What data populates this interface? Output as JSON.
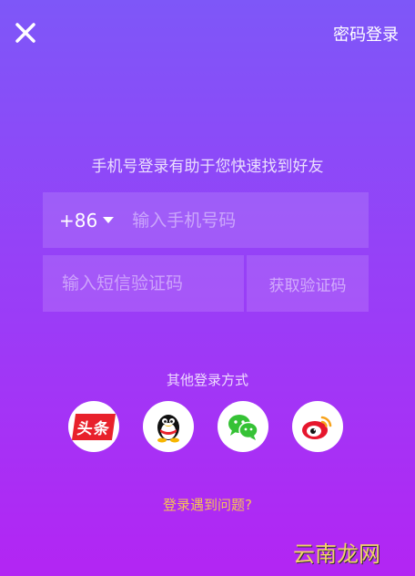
{
  "header": {
    "close_icon": "close-icon",
    "password_login_label": "密码登录"
  },
  "subtitle": "手机号登录有助于您快速找到好友",
  "phone": {
    "country_code": "+86",
    "placeholder": "输入手机号码",
    "value": ""
  },
  "sms": {
    "placeholder": "输入短信验证码",
    "value": "",
    "get_code_label": "获取验证码"
  },
  "other_login": {
    "title": "其他登录方式",
    "providers": [
      {
        "name": "toutiao",
        "label": "头条",
        "color": "#e8212b"
      },
      {
        "name": "qq",
        "icon": "qq-penguin-icon"
      },
      {
        "name": "wechat",
        "icon": "wechat-icon",
        "color": "#35c235"
      },
      {
        "name": "weibo",
        "icon": "weibo-icon",
        "color": "#e6162d"
      }
    ]
  },
  "help_link": "登录遇到问题?",
  "watermark": "云南龙网",
  "colors": {
    "background_top": "#7e57f8",
    "background_bottom": "#b325f3",
    "help_link": "#f6c256"
  }
}
